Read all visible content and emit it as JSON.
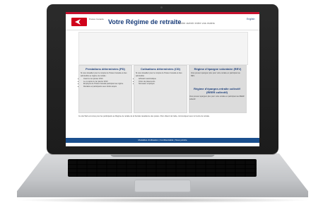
{
  "header": {
    "brand": "Postes Canada",
    "title": "Votre Régime de retraite",
    "subtitle": "Votre avenir entre vos mains",
    "lang_link": "English"
  },
  "columns": [
    {
      "heading": "Prestations déterminées (PD)",
      "intro": "Si vous travaillez pour le compte de Postes Canada et êtes admissible au régime de retraite :",
      "items": [
        "Avant le 1er janvier 2010",
        "Le ou après le 1er janvier 2010",
        "Employés de Postes Canada participant au régime",
        "Retraités et participants avec droits acquis"
      ]
    },
    {
      "heading": "Cotisations déterminées (CD)",
      "intro": "Si vous travaillez pour le compte de Postes Canada et êtes admissible :",
      "items": [
        "Adhésion automatique",
        "Choix de placements",
        "Nouveaux employés"
      ]
    },
    {
      "heading": "Régime d'épargne volontaire (REV)",
      "intro": "Vous pouvez épargner plus pour votre retraite en participant au REV."
    }
  ],
  "column3b": {
    "heading": "Régime d'épargne-retraite collectif (REER collectif)",
    "intro": "Vous pouvez épargner plus pour votre retraite en participant au REER collectif."
  },
  "footer": {
    "text": "Ce site Web est conçu pour les participants au Régime de retraite de la Société canadienne des postes. Pour obtenir de l'aide, communiquez avec le Centre de retraite.",
    "links": "Modalités d'utilisation | Confidentialité | Nous joindre"
  }
}
